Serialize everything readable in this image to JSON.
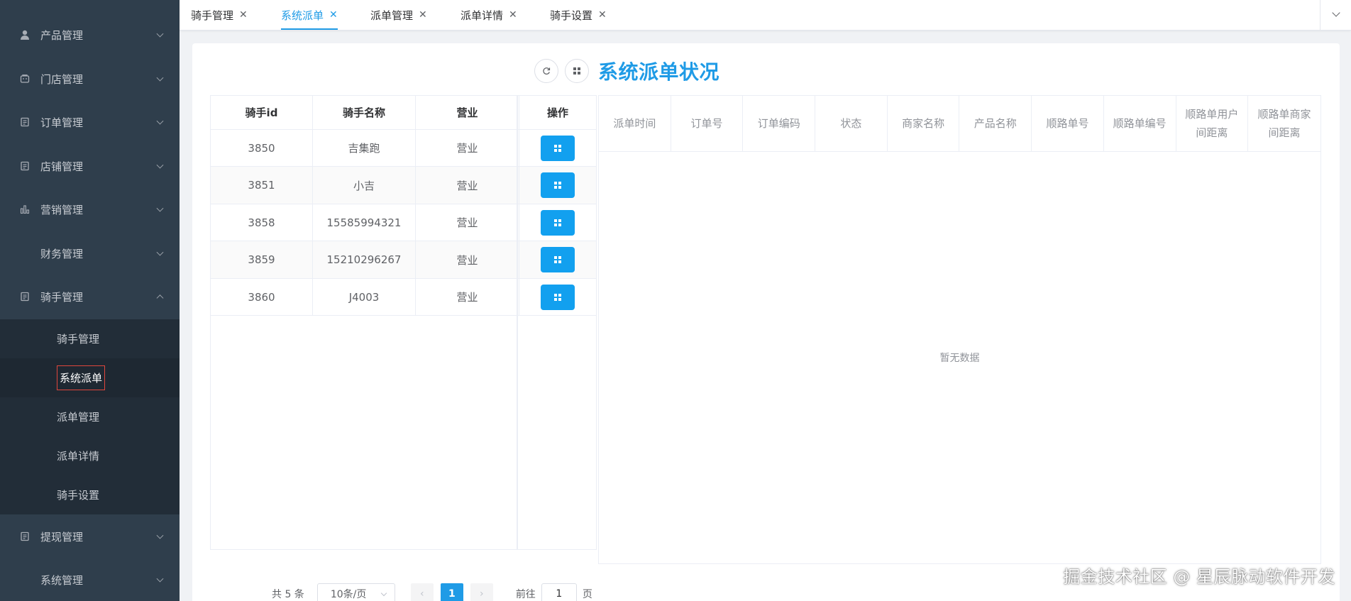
{
  "sidebar": {
    "menus": [
      {
        "label": "产品管理",
        "icon": "user-icon"
      },
      {
        "label": "门店管理",
        "icon": "store-icon"
      },
      {
        "label": "订单管理",
        "icon": "document-icon"
      },
      {
        "label": "店铺管理",
        "icon": "document-icon"
      },
      {
        "label": "营销管理",
        "icon": "bar-chart-icon"
      },
      {
        "label": "财务管理",
        "icon": ""
      },
      {
        "label": "骑手管理",
        "icon": "document-icon"
      }
    ],
    "rider_submenu": [
      "骑手管理",
      "系统派单",
      "派单管理",
      "派单详情",
      "骑手设置"
    ],
    "bottom_menus": [
      {
        "label": "提现管理",
        "icon": "document-icon"
      },
      {
        "label": "系统管理",
        "icon": ""
      }
    ],
    "active_item": "系统派单"
  },
  "tabs": [
    {
      "label": "骑手管理",
      "active": false
    },
    {
      "label": "系统派单",
      "active": true
    },
    {
      "label": "派单管理",
      "active": false
    },
    {
      "label": "派单详情",
      "active": false
    },
    {
      "label": "骑手设置",
      "active": false
    }
  ],
  "page": {
    "title": "系统派单状况"
  },
  "rider_table": {
    "columns": [
      "骑手id",
      "骑手名称",
      "营业",
      "操作"
    ],
    "rows": [
      {
        "id": "3850",
        "name": "吉集跑",
        "status": "营业"
      },
      {
        "id": "3851",
        "name": "小吉",
        "status": "营业"
      },
      {
        "id": "3858",
        "name": "15585994321",
        "status": "营业"
      },
      {
        "id": "3859",
        "name": "15210296267",
        "status": "营业"
      },
      {
        "id": "3860",
        "name": "J4003",
        "status": "营业"
      }
    ]
  },
  "dispatch_table": {
    "columns": [
      "派单时间",
      "订单号",
      "订单编码",
      "状态",
      "商家名称",
      "产品名称",
      "顺路单号",
      "顺路单编号",
      "顺路单用户间距离",
      "顺路单商家间距离"
    ],
    "empty_text": "暂无数据"
  },
  "pagination": {
    "total_text": "共 5 条",
    "page_size": "10条/页",
    "prev": "‹",
    "next": "›",
    "current_page": "1",
    "goto_prefix": "前往",
    "goto_value": "1",
    "goto_suffix": "页"
  },
  "watermark": "掘金技术社区 @ 星辰脉动软件开发",
  "colors": {
    "sidebar_bg": "#2f3e4c",
    "submenu_bg": "#222d38",
    "accent": "#1f9be6",
    "button": "#12a0ef",
    "highlight_border": "#e0463c"
  }
}
